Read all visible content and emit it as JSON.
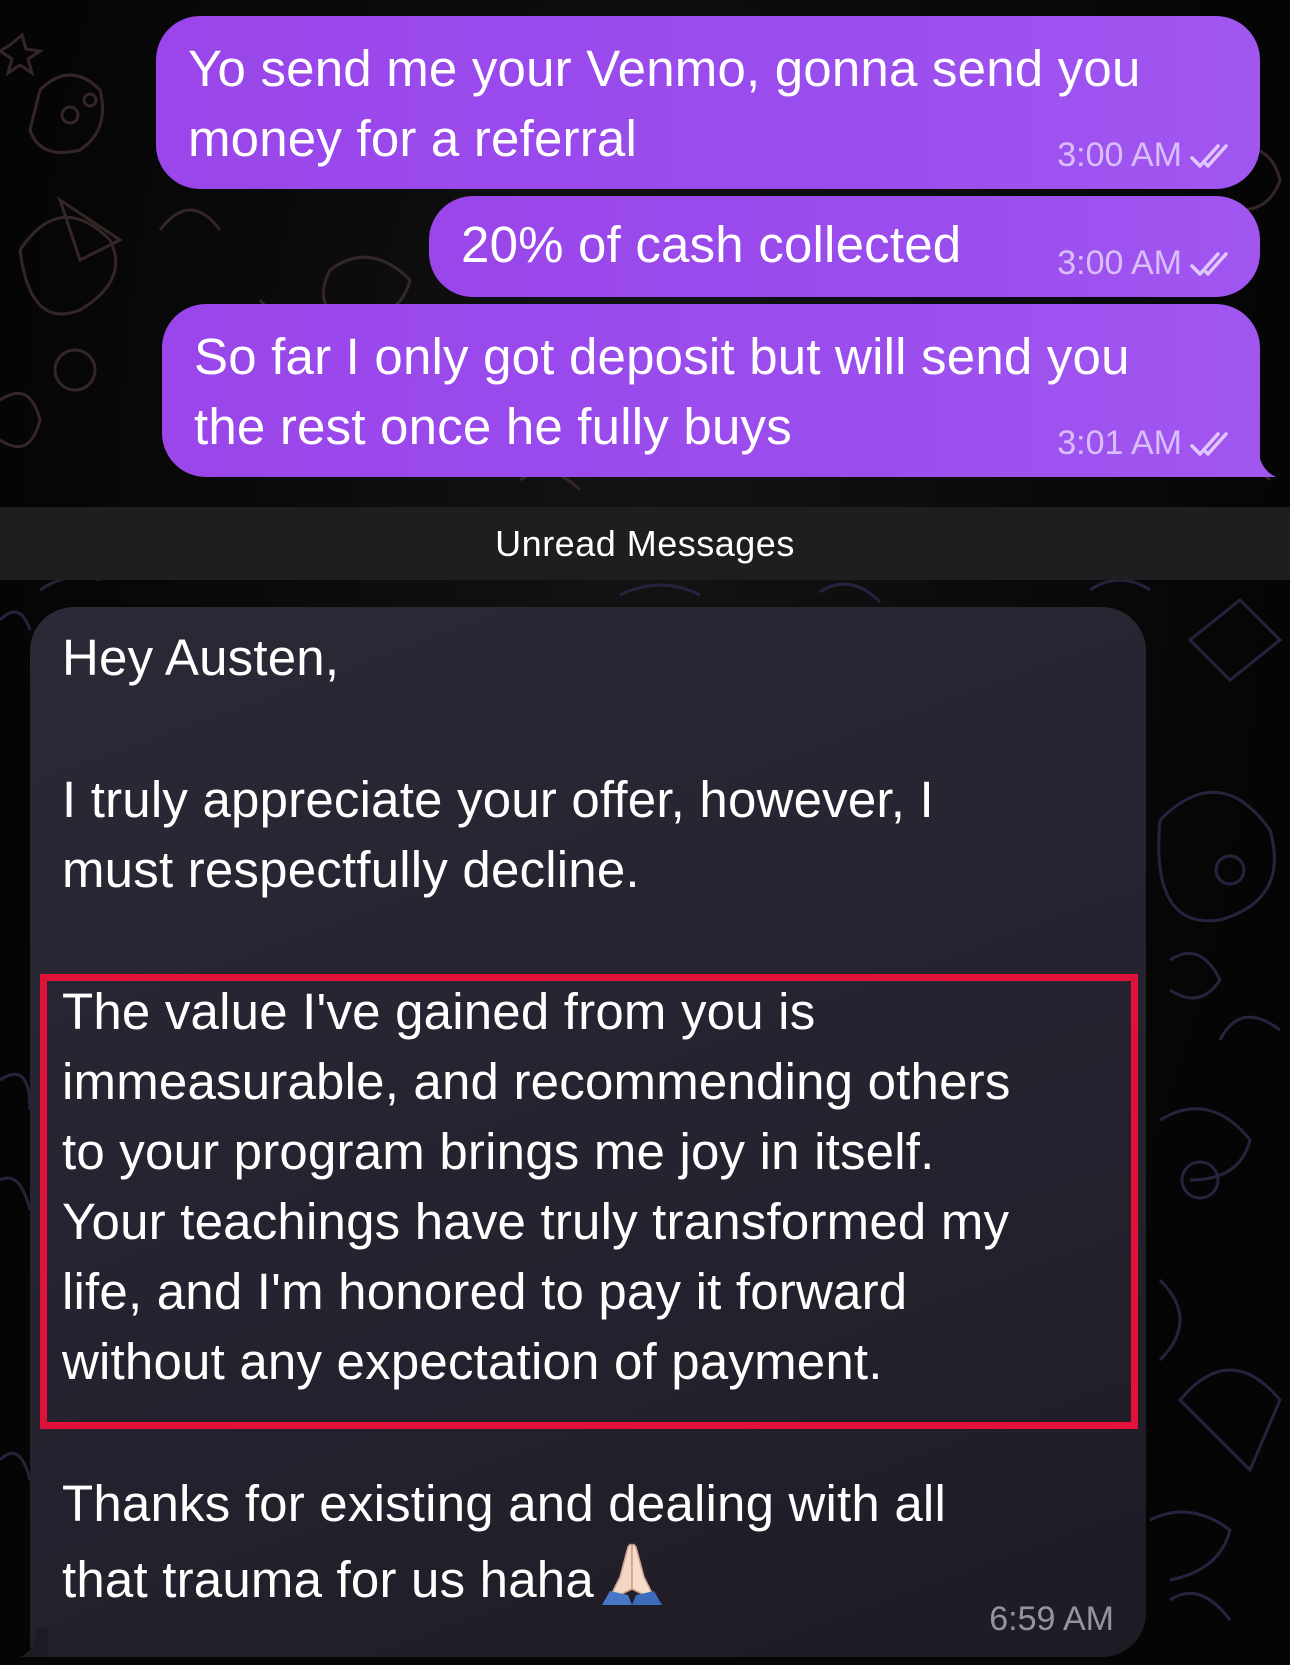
{
  "divider": {
    "label": "Unread Messages"
  },
  "outgoing": [
    {
      "text": "Yo send me your Venmo, gonna send you\nmoney for a referral",
      "time": "3:00 AM",
      "status": "read-double-check-icon"
    },
    {
      "text": "20% of cash collected",
      "time": "3:00 AM",
      "status": "read-double-check-icon"
    },
    {
      "text": "So far I only got deposit but will send you\nthe rest once he fully buys",
      "time": "3:01 AM",
      "status": "read-double-check-icon"
    }
  ],
  "incoming": {
    "greeting": "Hey Austen,",
    "para1": "I truly appreciate your offer, however, I\nmust respectfully decline.",
    "para2": "The value I've gained from you is\nimmeasurable, and recommending others\nto your program brings me joy in itself.\nYour teachings have truly transformed my\nlife, and I'm honored to pay it forward\nwithout any expectation of payment.",
    "para3": "Thanks for existing and dealing with all\nthat trauma for us haha",
    "emoji": "praying-hands-icon",
    "time": "6:59 AM"
  },
  "colors": {
    "outgoing_bubble": "#9a4ded",
    "incoming_bubble": "#27232f",
    "highlight": "#e1123a",
    "background": "#000000"
  }
}
